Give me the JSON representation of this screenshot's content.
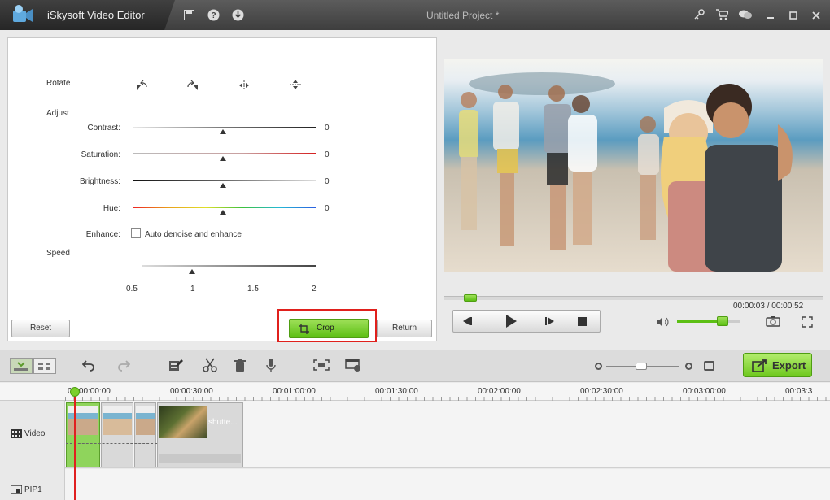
{
  "app": {
    "title": "iSkysoft Video Editor",
    "project": "Untitled Project *"
  },
  "titlebar": {
    "icons": [
      "save-icon",
      "help-icon",
      "download-icon"
    ],
    "right_icons": [
      "key-icon",
      "cart-icon",
      "chat-icon",
      "minimize-icon",
      "maximize-icon",
      "close-icon"
    ]
  },
  "edit": {
    "rotate_label": "Rotate",
    "adjust_label": "Adjust",
    "contrast_label": "Contrast:",
    "contrast_value": "0",
    "saturation_label": "Saturation:",
    "saturation_value": "0",
    "brightness_label": "Brightness:",
    "brightness_value": "0",
    "hue_label": "Hue:",
    "hue_value": "0",
    "enhance_label": "Enhance:",
    "enhance_option": "Auto denoise and enhance",
    "enhance_checked": false,
    "speed_label": "Speed",
    "speed_ticks": [
      "0.5",
      "1",
      "1.5",
      "2"
    ],
    "speed_value": 1,
    "reset_label": "Reset",
    "crop_label": "Crop",
    "return_label": "Return"
  },
  "player": {
    "time": "00:00:03 / 00:00:52",
    "volume": 0.75,
    "progress": 0.06
  },
  "timeline": {
    "export_label": "Export",
    "ruler": [
      "00:00:00:00",
      "00:00:30:00",
      "00:01:00:00",
      "00:01:30:00",
      "00:02:00:00",
      "00:02:30:00",
      "00:03:00:00",
      "00:03:3"
    ],
    "video_label": "Video",
    "pip_label": "PIP1",
    "clip_text": "shutte..."
  },
  "colors": {
    "accent_green": "#7ccf2b",
    "crop_highlight": "#e0201c",
    "title_bg": "#454545"
  }
}
